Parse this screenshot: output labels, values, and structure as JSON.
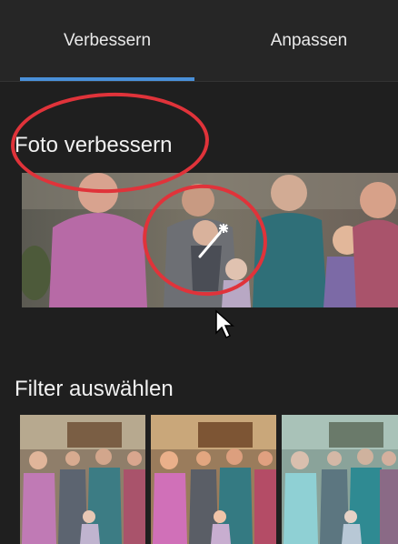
{
  "tabs": [
    {
      "label": "Verbessern",
      "active": true
    },
    {
      "label": "Anpassen",
      "active": false
    }
  ],
  "enhance": {
    "title": "Foto verbessern",
    "icon": "magic-wand-icon"
  },
  "filters": {
    "title": "Filter auswählen",
    "thumbnails": [
      "filter-thumbnail-1",
      "filter-thumbnail-2",
      "filter-thumbnail-3"
    ]
  },
  "colors": {
    "accent": "#4a90d9",
    "annotation": "#e0333a",
    "panel_bg": "#1f1f1f"
  }
}
